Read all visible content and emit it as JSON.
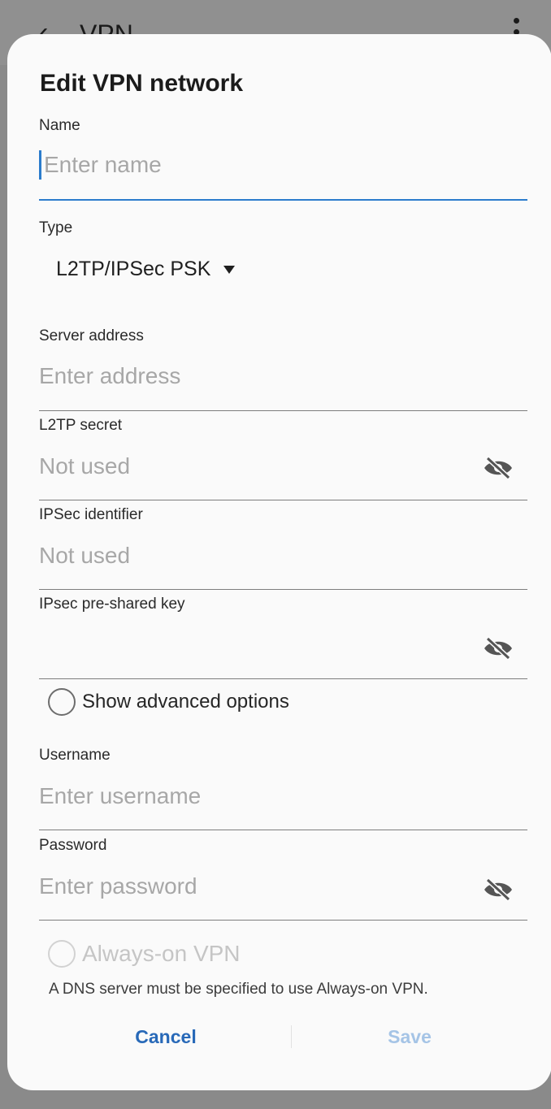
{
  "background": {
    "back_label": "‹",
    "title": "VPN"
  },
  "dialog": {
    "title": "Edit VPN network",
    "name": {
      "label": "Name",
      "placeholder": "Enter name"
    },
    "type": {
      "label": "Type",
      "value": "L2TP/IPSec PSK"
    },
    "server": {
      "label": "Server address",
      "placeholder": "Enter address"
    },
    "l2tp_secret": {
      "label": "L2TP secret",
      "placeholder": "Not used"
    },
    "ipsec_identifier": {
      "label": "IPSec identifier",
      "placeholder": "Not used"
    },
    "ipsec_psk": {
      "label": "IPsec pre-shared key",
      "placeholder": ""
    },
    "show_advanced": {
      "label": "Show advanced options"
    },
    "username": {
      "label": "Username",
      "placeholder": "Enter username"
    },
    "password": {
      "label": "Password",
      "placeholder": "Enter password"
    },
    "always_on": {
      "label": "Always-on VPN"
    },
    "helper_text": "A DNS server must be specified to use Always-on VPN.",
    "cancel_label": "Cancel",
    "save_label": "Save"
  },
  "colors": {
    "accent": "#2b7ccc",
    "button_active": "#2869b8",
    "button_disabled": "#a5c4e6",
    "placeholder": "#a7a7a7"
  },
  "icons": {
    "visibility_toggle": "eye-off-icon",
    "dropdown": "caret-down-icon"
  }
}
